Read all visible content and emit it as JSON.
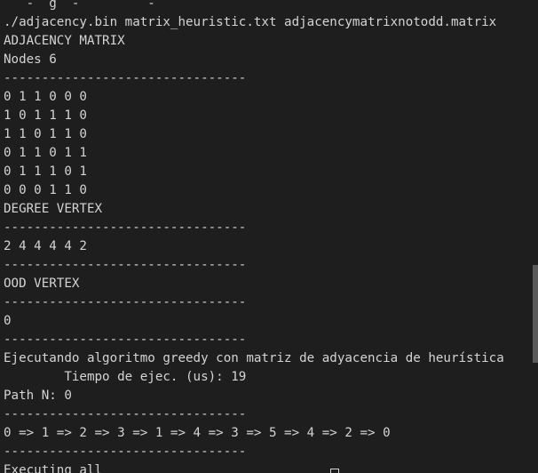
{
  "terminal": {
    "lines": [
      "   -  g  -         -    ",
      "./adjacency.bin matrix_heuristic.txt adjacencymatrixnotodd.matrix",
      "ADJACENCY MATRIX",
      "Nodes 6",
      "--------------------------------",
      "0 1 1 0 0 0",
      "1 0 1 1 1 0",
      "1 1 0 1 1 0",
      "0 1 1 0 1 1",
      "0 1 1 1 0 1",
      "0 0 0 1 1 0",
      "DEGREE VERTEX",
      "--------------------------------",
      "2 4 4 4 4 2",
      "--------------------------------",
      "OOD VERTEX",
      "--------------------------------",
      "0",
      "--------------------------------",
      "Ejecutando algoritmo greedy con matriz de adyacencia de heurística",
      "        Tiempo de ejec. (us): 19",
      "Path N: 0",
      "--------------------------------",
      "0 => 1 => 2 => 3 => 1 => 4 => 3 => 5 => 4 => 2 => 0",
      "--------------------------------",
      "Executing all"
    ]
  },
  "colors": {
    "background": "#1e1e1e",
    "foreground": "#d4d4d4",
    "scrollbar_thumb": "#5a5a5a"
  },
  "icons": {
    "cursor": "block-cursor-icon"
  }
}
